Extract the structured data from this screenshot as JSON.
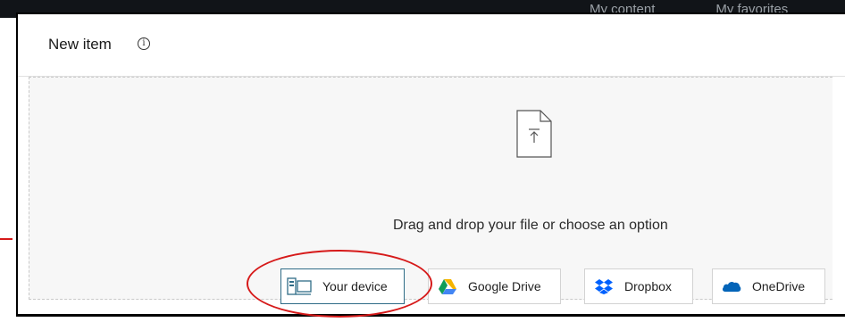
{
  "background": {
    "tabs": [
      "My content",
      "My favorites"
    ]
  },
  "dialog": {
    "title": "New item",
    "info_icon": "info-icon",
    "dropzone_text": "Drag and drop your file or choose an option",
    "upload_icon": "file-upload-icon",
    "options": [
      {
        "label": "Your device",
        "icon": "device-icon"
      },
      {
        "label": "Google Drive",
        "icon": "google-drive-icon"
      },
      {
        "label": "Dropbox",
        "icon": "dropbox-icon"
      },
      {
        "label": "OneDrive",
        "icon": "onedrive-icon"
      }
    ]
  },
  "colors": {
    "selected_border": "#2f6c87",
    "annotation": "#d61a1a",
    "dropzone_bg": "#f7f7f7"
  }
}
